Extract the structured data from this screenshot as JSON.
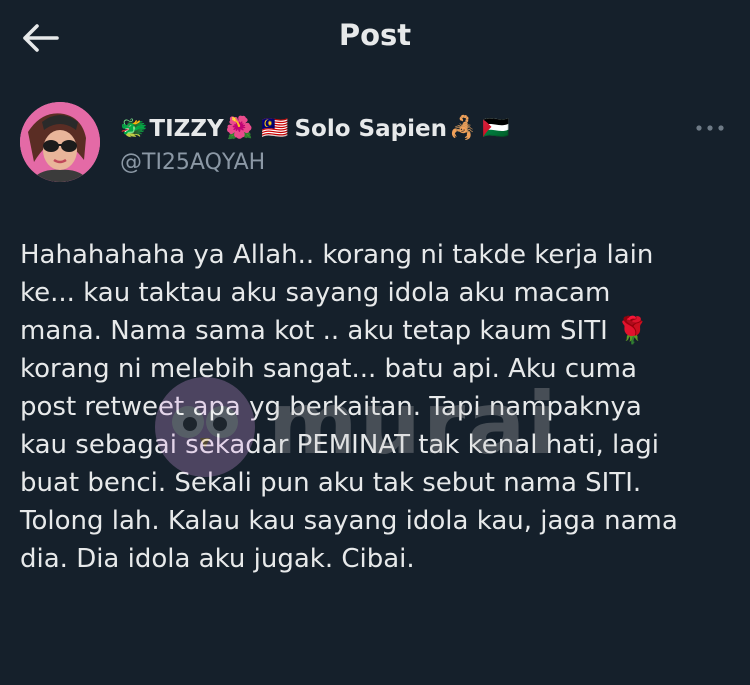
{
  "header": {
    "title": "Post"
  },
  "author": {
    "display_name_prefix_emoji": "🐲",
    "display_name_part1": "TIZZY",
    "emoji_hibiscus": "🌺",
    "emoji_flag_my": "🇲🇾",
    "display_name_part2": "Solo Sapien",
    "emoji_scorpion": "🦂",
    "emoji_flag_ps": "🇵🇸",
    "handle": "@TI25AQYAH"
  },
  "post": {
    "lines": [
      "Hahahahaha ya Allah.. korang ni takde kerja lain",
      "ke... kau taktau aku sayang idola aku macam",
      "mana. Nama sama kot .. aku tetap kaum SITI",
      "korang ni melebih sangat... batu api. Aku cuma",
      "post retweet apa yg berkaitan. Tapi nampaknya",
      "kau sebagai sekadar PEMINAT tak kenal hati, lagi",
      "buat benci. Sekali pun aku tak sebut nama SITI.",
      "Tolong lah. Kalau kau sayang idola kau, jaga nama",
      "dia. Dia idola aku jugak. Cibai."
    ],
    "rose_emoji": "🌹"
  },
  "watermark": {
    "text": "murai"
  },
  "colors": {
    "background": "#15202b",
    "text_primary": "#e7e9ea",
    "text_secondary": "#8b98a5"
  },
  "icons": {
    "back": "arrow-left-icon",
    "more": "more-horizontal-icon"
  }
}
